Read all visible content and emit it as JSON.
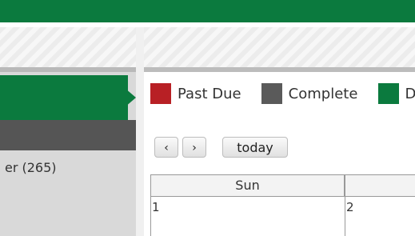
{
  "colors": {
    "brand_green": "#0b7a3e",
    "past_due": "#b82025",
    "complete": "#5a5a5a",
    "due": "#0b7a3e"
  },
  "sidebar": {
    "items": [
      {
        "label": "er (265)"
      }
    ]
  },
  "legend": [
    {
      "label": "Past Due",
      "color": "#b82025"
    },
    {
      "label": "Complete",
      "color": "#5a5a5a"
    },
    {
      "label": "Du",
      "color": "#0b7a3e"
    }
  ],
  "calendar": {
    "nav": {
      "prev": "‹",
      "next": "›",
      "today": "today"
    },
    "headers": [
      "Sun"
    ],
    "day_numbers": [
      "1",
      "2"
    ]
  }
}
